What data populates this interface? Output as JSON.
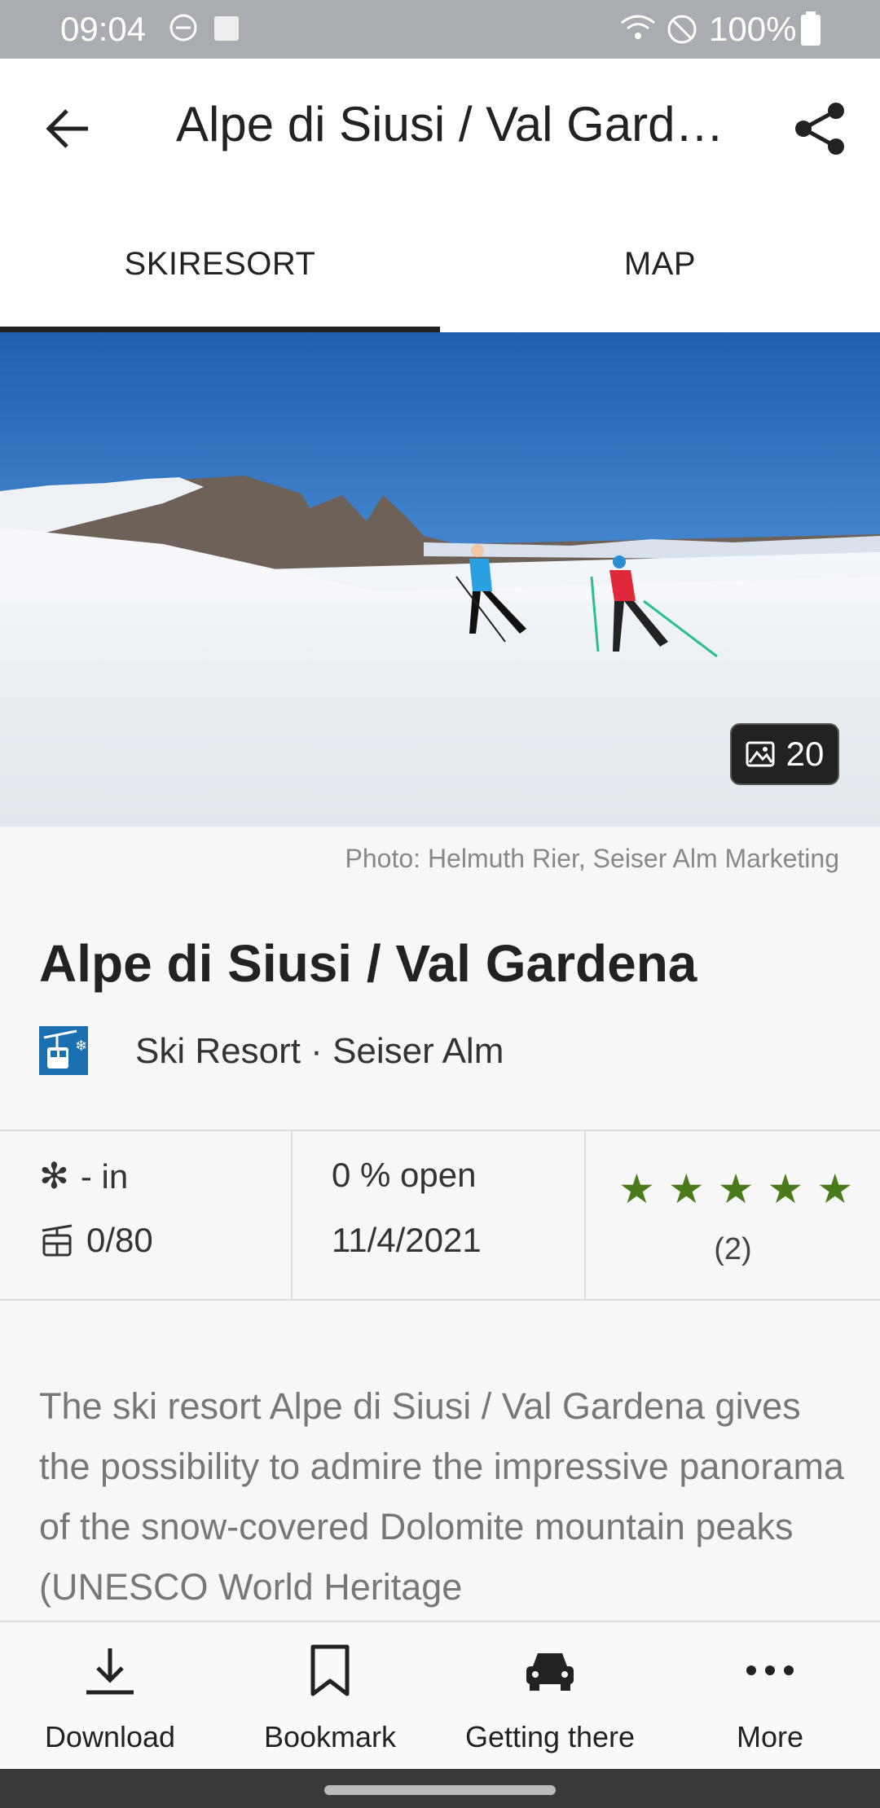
{
  "status_bar": {
    "time": "09:04",
    "battery": "100%"
  },
  "app_bar": {
    "title": "Alpe di Siusi / Val Gardena"
  },
  "tabs": [
    {
      "label": "SKIRESORT",
      "selected": true
    },
    {
      "label": "MAP",
      "selected": false
    }
  ],
  "hero": {
    "photo_count": "20"
  },
  "photo_credit": "Photo: Helmuth Rier, Seiser Alm Marketing",
  "resort": {
    "name": "Alpe di Siusi / Val Gardena",
    "type": "Ski Resort",
    "region": "Seiser Alm"
  },
  "stats": {
    "snow": "- in",
    "lifts": "0/80",
    "open": "0 % open",
    "date": "11/4/2021",
    "rating_stars": 5,
    "rating_count": "(2)"
  },
  "description": "The ski resort Alpe di Siusi / Val Gardena gives the possibility to admire the impressive panorama of the snow-covered Dolomite mountain peaks (UNESCO World Heritage",
  "bottom_bar": [
    {
      "label": "Download",
      "icon": "download-icon"
    },
    {
      "label": "Bookmark",
      "icon": "bookmark-icon"
    },
    {
      "label": "Getting there",
      "icon": "car-icon"
    },
    {
      "label": "More",
      "icon": "more-icon"
    }
  ],
  "colors": {
    "rating_star": "#4a7a1a",
    "resort_icon_bg": "#1a6fb0",
    "tab_indicator": "#222222"
  }
}
